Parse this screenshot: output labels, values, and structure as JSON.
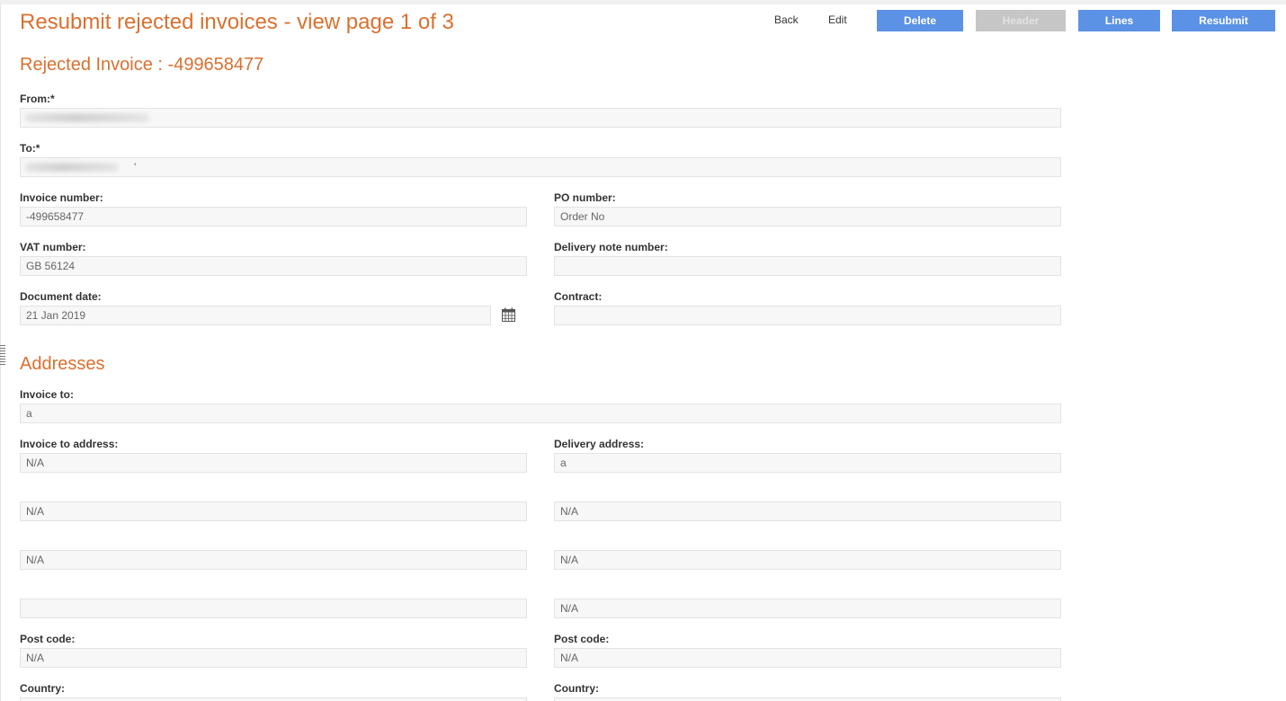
{
  "page": {
    "title": "Resubmit rejected invoices - view page 1 of 3",
    "invoice_heading": "Rejected Invoice : -499658477",
    "addresses_heading": "Addresses"
  },
  "toolbar": {
    "back_label": "Back",
    "edit_label": "Edit",
    "delete_label": "Delete",
    "header_label": "Header",
    "lines_label": "Lines",
    "resubmit_label": "Resubmit",
    "primary_color": "#5b92e5",
    "disabled_color": "#c6c6c6"
  },
  "colors": {
    "heading": "#d9702f"
  },
  "icons": {
    "calendar": "calendar-icon"
  },
  "header_fields": {
    "from": {
      "label": "From:*",
      "value": ""
    },
    "to": {
      "label": "To:*",
      "value": "'"
    },
    "invoice_number": {
      "label": "Invoice number:",
      "value": "-499658477"
    },
    "po_number": {
      "label": "PO number:",
      "value": "Order No"
    },
    "vat_number": {
      "label": "VAT number:",
      "value": "GB 56124"
    },
    "delivery_note_number": {
      "label": "Delivery note number:",
      "value": ""
    },
    "document_date": {
      "label": "Document date:",
      "value": "21 Jan 2019"
    },
    "contract": {
      "label": "Contract:",
      "value": ""
    }
  },
  "addresses": {
    "invoice_to": {
      "label": "Invoice to:",
      "value": "a"
    },
    "invoice_to_address": {
      "label": "Invoice to address:",
      "lines": [
        "N/A",
        "N/A",
        "N/A",
        ""
      ]
    },
    "delivery_address": {
      "label": "Delivery address:",
      "lines": [
        "a",
        "N/A",
        "N/A",
        "N/A"
      ]
    },
    "invoice_post_code": {
      "label": "Post code:",
      "value": "N/A"
    },
    "delivery_post_code": {
      "label": "Post code:",
      "value": "N/A"
    },
    "invoice_country": {
      "label": "Country:"
    },
    "delivery_country": {
      "label": "Country:"
    }
  }
}
